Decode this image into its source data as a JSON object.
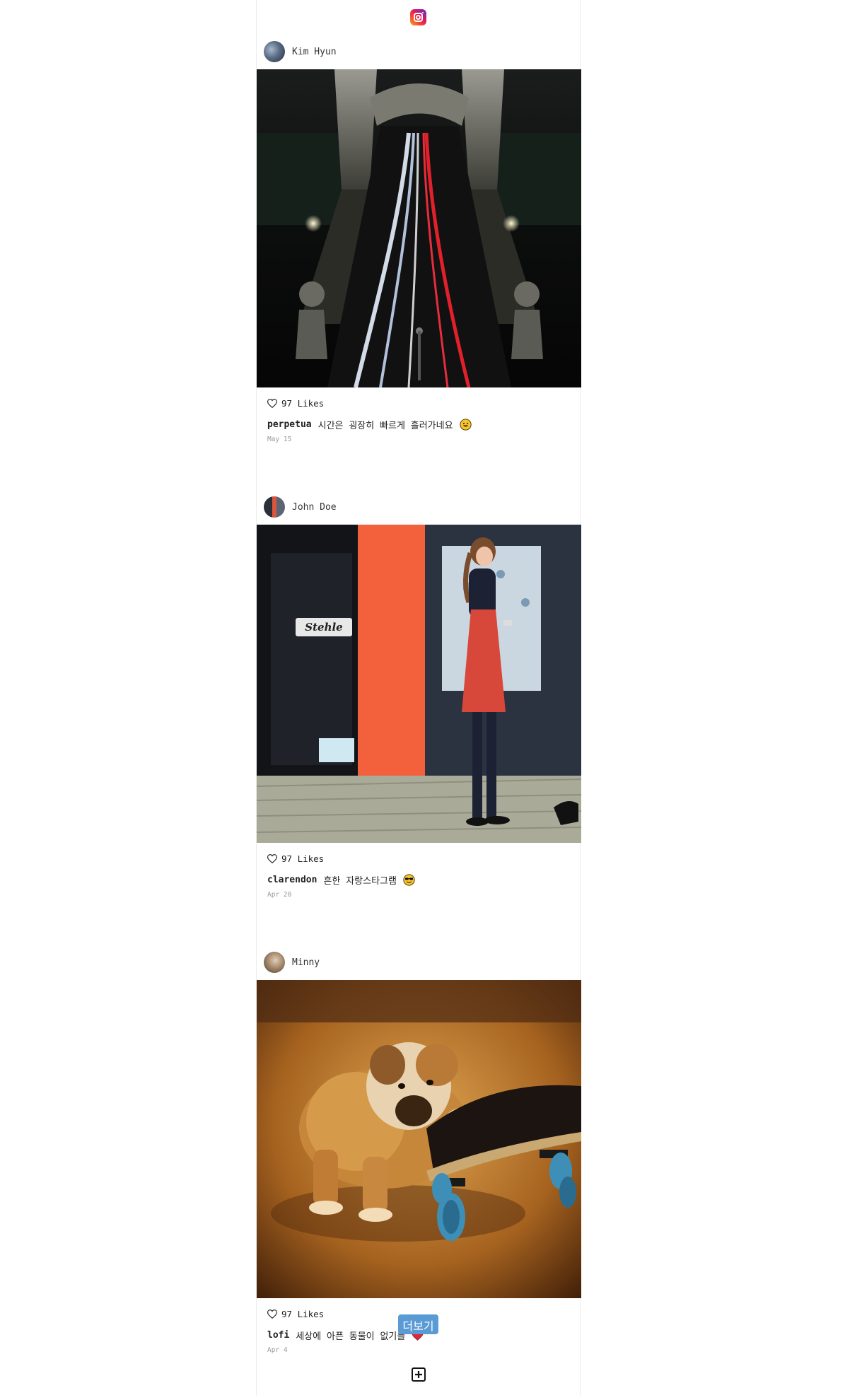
{
  "header": {
    "logo_icon": "instagram-logo-icon"
  },
  "posts": [
    {
      "username": "Kim Hyun",
      "likes": "97 Likes",
      "filter": "perpetua",
      "caption": "시간은 굉장히 빠르게 흘러가네요",
      "emoji": "grinning-face-emoji",
      "date": "May 15",
      "photo": "night-bridge-light-trails-photo"
    },
    {
      "username": "John Doe",
      "likes": "97 Likes",
      "filter": "clarendon",
      "caption": "흔한 자랑스타그램",
      "emoji": "sunglasses-face-emoji",
      "date": "Apr 20",
      "photo": "woman-with-phone-street-photo"
    },
    {
      "username": "Minny",
      "likes": "97 Likes",
      "filter": "lofi",
      "caption": "세상에 아픈 동물이 없기를",
      "emoji": "red-heart-emoji",
      "date": "Apr 4",
      "photo": "bulldog-puppy-skateboard-photo"
    }
  ],
  "more_button": {
    "label": "더보기",
    "color": "#5b9bd5"
  },
  "add_button": {
    "icon": "plus-square-icon"
  }
}
